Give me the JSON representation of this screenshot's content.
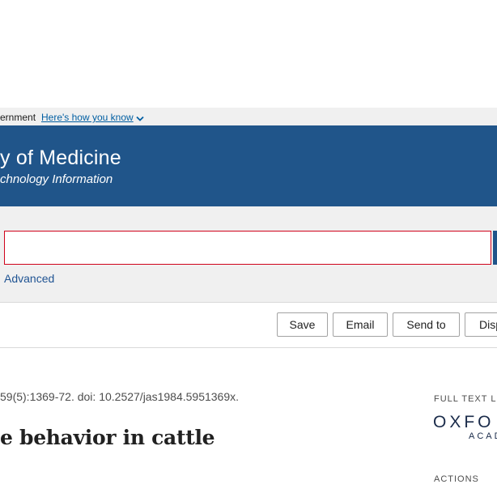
{
  "gov_banner": {
    "text": "ernment",
    "link": "Here's how you know"
  },
  "header": {
    "title_main": "y of Medicine",
    "title_sub": "chnology Information",
    "colors": {
      "background": "#20558a",
      "text": "#ffffff"
    }
  },
  "search": {
    "value": "",
    "placeholder": "",
    "advanced_label": "Advanced",
    "border_color": "#d0021b"
  },
  "toolbar": {
    "save_label": "Save",
    "email_label": "Email",
    "send_to_label": "Send to",
    "display_label": "Disp"
  },
  "article": {
    "citation": "59(5):1369-72. doi: 10.2527/jas1984.5951369x.",
    "title": "e behavior in cattle"
  },
  "sidebar": {
    "full_text_label": "FULL TEXT LI",
    "logo_top": "OXFO",
    "logo_bottom": "ACAD",
    "actions_label": "ACTIONS"
  }
}
